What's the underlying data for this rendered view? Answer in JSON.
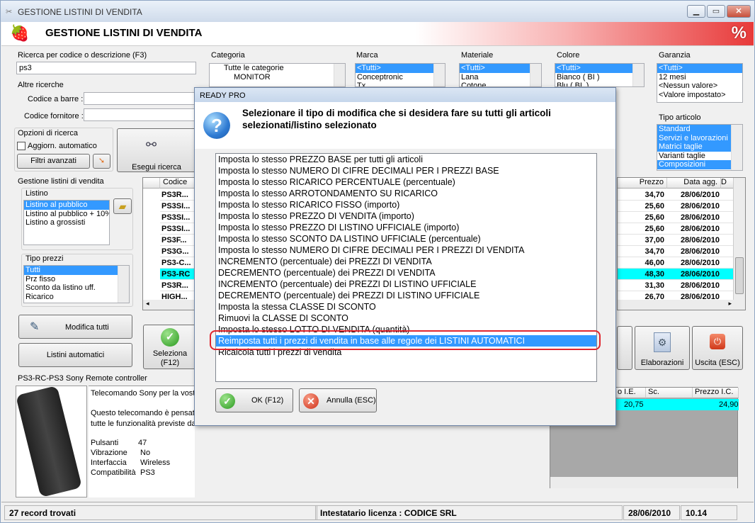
{
  "window": {
    "title": "GESTIONE LISTINI DI VENDITA",
    "banner_title": "GESTIONE LISTINI DI VENDITA"
  },
  "search": {
    "label": "Ricerca per codice o descrizione (F3)",
    "value": "ps3",
    "other_label": "Altre ricerche",
    "barcode_label": "Codice a barre :",
    "supplier_label": "Codice fornitore :"
  },
  "filters": {
    "categoria": {
      "label": "Categoria",
      "items": [
        "Tutte le categorie",
        "MONITOR"
      ]
    },
    "marca": {
      "label": "Marca",
      "items": [
        "<Tutti>",
        "Conceptronic",
        "Tx"
      ]
    },
    "materiale": {
      "label": "Materiale",
      "items": [
        "<Tutti>",
        "Lana",
        "Cotone"
      ]
    },
    "colore": {
      "label": "Colore",
      "items": [
        "<Tutti>",
        "Bianco ( BI )",
        "Blu ( BL )"
      ]
    },
    "garanzia": {
      "label": "Garanzia",
      "items": [
        "<Tutti>",
        "12 mesi",
        "<Nessun valore>",
        "<Valore impostato>"
      ]
    },
    "tipo_articolo": {
      "label": "Tipo articolo",
      "items": [
        "Standard",
        "Servizi e lavorazioni",
        "Matrici taglie",
        "Varianti taglie",
        "Composizioni"
      ]
    }
  },
  "options": {
    "label": "Opzioni di ricerca",
    "auto_update": "Aggiorn. automatico",
    "advanced_filters": "Filtri avanzati",
    "run_search": "Esegui ricerca"
  },
  "pricelists": {
    "label": "Gestione listini di vendita",
    "list_label": "Listino",
    "lists": [
      "Listino al pubblico",
      "Listino al pubblico + 10%",
      "Listino a grossisti"
    ],
    "price_type_label": "Tipo prezzi",
    "price_types": [
      "Tutti",
      "Prz fisso",
      "Sconto da listino uff.",
      "Ricarico"
    ],
    "modify_all": "Modifica tutti",
    "auto_lists": "Listini automatici"
  },
  "grid": {
    "code_header": "Codice",
    "price_header": "Prezzo",
    "date_header": "Data agg.",
    "extra_header": "D",
    "codes": [
      "PS3R...",
      "PS3SI...",
      "PS3SI...",
      "PS3SI...",
      "PS3F...",
      "PS3G...",
      "PS3-C...",
      "PS3-RC",
      "PS3R...",
      "HIGH..."
    ],
    "prices": [
      "34,70",
      "25,60",
      "25,60",
      "25,60",
      "37,00",
      "34,70",
      "46,00",
      "48,30",
      "31,30",
      "26,70"
    ],
    "dates": [
      "28/06/2010",
      "28/06/2010",
      "28/06/2010",
      "28/06/2010",
      "28/06/2010",
      "28/06/2010",
      "28/06/2010",
      "28/06/2010",
      "28/06/2010",
      "28/06/2010"
    ]
  },
  "actions": {
    "select": "Seleziona (F12)",
    "elaborations": "Elaborazioni",
    "exit": "Uscita (ESC)"
  },
  "detail": {
    "title": "PS3-RC-PS3 Sony Remote controller",
    "desc1": "Telecomando Sony per la vost",
    "desc2": "Questo telecomando è pensato",
    "desc3": "tutte le funzionalità previste da",
    "specs": [
      {
        "k": "Pulsanti",
        "v": "47"
      },
      {
        "k": "Vibrazione",
        "v": "No"
      },
      {
        "k": "Interfaccia",
        "v": "Wireless"
      },
      {
        "k": "Compatibilità",
        "v": "PS3"
      }
    ],
    "lower_headers": {
      "pie": "o I.E.",
      "sc": "Sc.",
      "pic": "Prezzo I.C."
    },
    "lower_values": {
      "pie": "20,75",
      "pic": "24,90"
    }
  },
  "dialog": {
    "title": "READY PRO",
    "message": "Selezionare il tipo di modifica che si desidera fare su tutti gli articoli selezionati/listino selezionato",
    "options": [
      "Imposta lo stesso PREZZO BASE per tutti gli articoli",
      "Imposta lo stesso NUMERO DI CIFRE DECIMALI PER I PREZZI BASE",
      "Imposta lo stesso RICARICO PERCENTUALE (percentuale)",
      "Imposta lo stesso ARROTONDAMENTO SU RICARICO",
      "Imposta lo stesso RICARICO FISSO (importo)",
      "Imposta lo stesso PREZZO DI VENDITA (importo)",
      "Imposta lo stesso PREZZO DI LISTINO UFFICIALE (importo)",
      "Imposta lo stesso SCONTO DA LISTINO UFFICIALE (percentuale)",
      "Imposta lo stesso NUMERO DI CIFRE DECIMALI PER I PREZZI DI VENDITA",
      "INCREMENTO (percentuale) dei PREZZI DI VENDITA",
      "DECREMENTO (percentuale) dei PREZZI DI VENDITA",
      "INCREMENTO (percentuale) dei PREZZI DI LISTINO UFFICIALE",
      "DECREMENTO (percentuale) dei PREZZI DI LISTINO UFFICIALE",
      "Imposta la stessa CLASSE DI SCONTO",
      "Rimuovi la CLASSE DI SCONTO",
      "Imposta lo stesso LOTTO DI VENDITA (quantità)",
      "Reimposta tutti i prezzi di vendita in base alle regole dei LISTINI AUTOMATICI",
      "Ricalcola tutti i prezzi di vendita"
    ],
    "selected_index": 16,
    "ok": "OK (F12)",
    "cancel": "Annulla (ESC)"
  },
  "status": {
    "records": "27 record trovati",
    "license": "Intestatario licenza : CODICE SRL",
    "date": "28/06/2010",
    "time": "10.14"
  }
}
